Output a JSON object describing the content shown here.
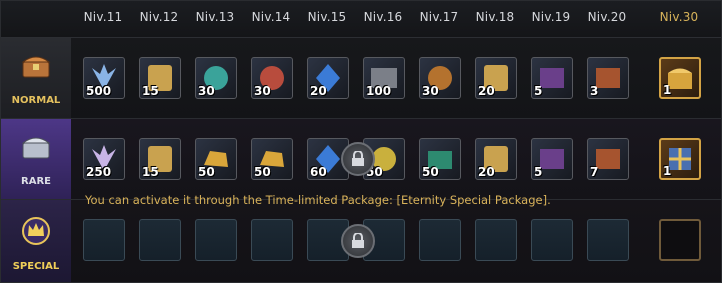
{
  "levels": [
    "Niv.11",
    "Niv.12",
    "Niv.13",
    "Niv.14",
    "Niv.15",
    "Niv.16",
    "Niv.17",
    "Niv.18",
    "Niv.19",
    "Niv.20",
    "Niv.30"
  ],
  "tiers": {
    "normal": {
      "label": "NORMAL",
      "quantities": [
        "500",
        "15",
        "30",
        "30",
        "20",
        "100",
        "30",
        "20",
        "5",
        "3",
        "1"
      ]
    },
    "rare": {
      "label": "RARE",
      "quantities": [
        "250",
        "15",
        "50",
        "50",
        "60",
        "50",
        "50",
        "20",
        "5",
        "7",
        "1"
      ]
    },
    "special": {
      "label": "SPECIAL"
    }
  },
  "notice": "You can activate it through the Time-limited Package: [Eternity Special Package].",
  "colors": {
    "gold": "#d7b35a",
    "rare_purple": "#4d3787",
    "panel": "#121316"
  },
  "icons": [
    "chest-icon",
    "lock-icon",
    "crown-icon"
  ]
}
